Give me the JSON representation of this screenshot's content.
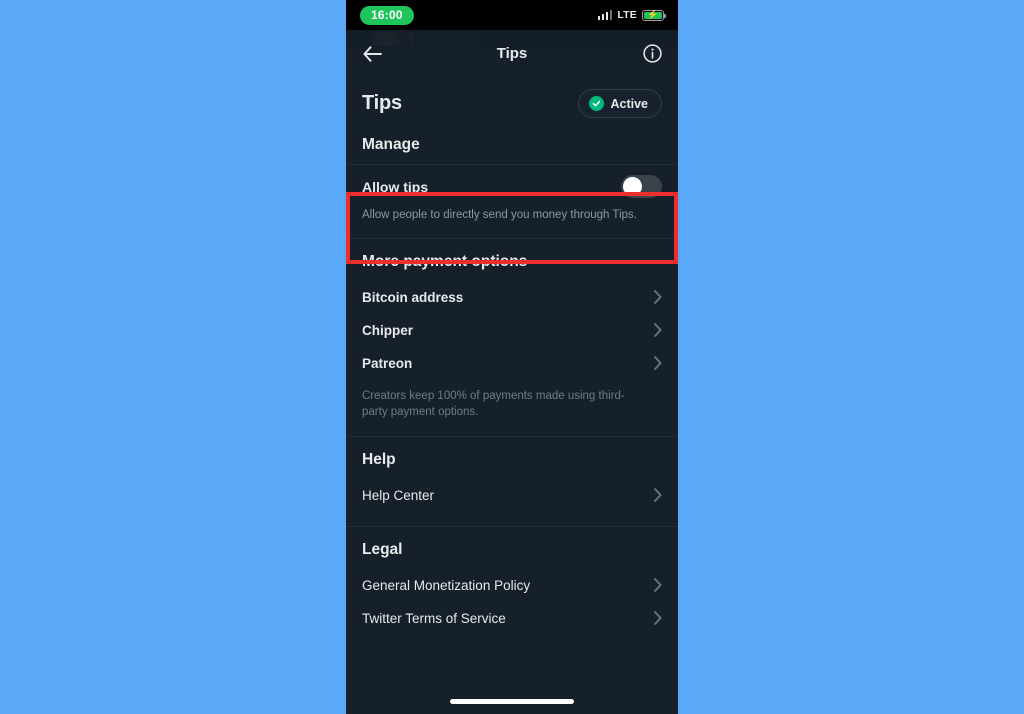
{
  "status_bar": {
    "time": "16:00",
    "network": "LTE",
    "signal_icon": "signal-bars-icon",
    "battery_icon": "battery-charging-icon"
  },
  "background": {
    "ghost_handle": "@ayokxnle"
  },
  "navbar": {
    "back_icon": "back-arrow-icon",
    "title": "Tips",
    "info_icon": "info-circle-icon"
  },
  "page": {
    "title": "Tips",
    "status_badge": {
      "label": "Active",
      "check_icon": "check-circle-icon",
      "color": "#00ba7c"
    }
  },
  "manage": {
    "heading": "Manage",
    "allow_tips": {
      "label": "Allow tips",
      "description": "Allow people to directly send you money through Tips.",
      "toggle_state": "off"
    }
  },
  "payment_options": {
    "heading": "More payment options",
    "items": [
      {
        "label": "Bitcoin address",
        "chevron_icon": "chevron-right-icon"
      },
      {
        "label": "Chipper",
        "chevron_icon": "chevron-right-icon"
      },
      {
        "label": "Patreon",
        "chevron_icon": "chevron-right-icon"
      }
    ],
    "note": "Creators keep 100% of payments made using third-party payment options."
  },
  "help": {
    "heading": "Help",
    "items": [
      {
        "label": "Help Center",
        "chevron_icon": "chevron-right-icon"
      }
    ]
  },
  "legal": {
    "heading": "Legal",
    "items": [
      {
        "label": "General Monetization Policy",
        "chevron_icon": "chevron-right-icon"
      },
      {
        "label": "Twitter Terms of Service",
        "chevron_icon": "chevron-right-icon"
      }
    ]
  },
  "home_indicator": "home-indicator-bar",
  "annotation": {
    "highlight_color": "#ee2d2d",
    "target": "allow-tips-row"
  }
}
